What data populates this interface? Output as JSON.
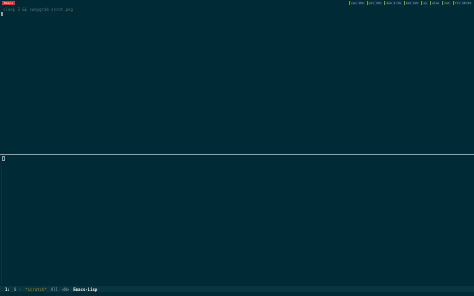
{
  "topbar": {
    "active_workspace": "Emacs",
    "status_items": [
      "cpu 10%",
      "vol 45%",
      "mem 2.3G",
      "bat 92%",
      "up",
      "wlan",
      "net",
      "fri 18:04"
    ]
  },
  "terminal": {
    "command": "sleep 3 && swaygrab scrot.png"
  },
  "modeline": {
    "number": "1:",
    "flags": "0 -",
    "buffer": "*scratch*",
    "position": "All",
    "extra": "<N>",
    "mode": "Emacs-Lisp"
  },
  "colors": {
    "background": "#002b36",
    "modeline_bg": "#073642",
    "accent_red": "#dc322f",
    "buffer_yellow": "#b58900"
  }
}
